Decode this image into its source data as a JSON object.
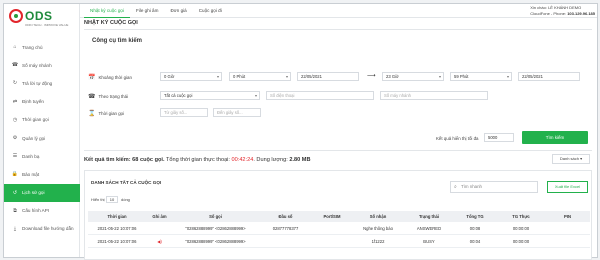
{
  "logo": {
    "text": "ODS",
    "subtitle": "ODIN TECH · IMPROVE VALUE"
  },
  "sidebar": {
    "items": [
      {
        "label": "Trang chủ",
        "icon": "home-icon",
        "active": false
      },
      {
        "label": "Số máy nhánh",
        "icon": "phone-icon",
        "active": false
      },
      {
        "label": "Trả lời tự động",
        "icon": "refresh-icon",
        "active": false
      },
      {
        "label": "Định tuyến",
        "icon": "route-icon",
        "active": false
      },
      {
        "label": "Thời gian gọi",
        "icon": "clock-icon",
        "active": false
      },
      {
        "label": "Quản lý gọi",
        "icon": "settings-icon",
        "active": false
      },
      {
        "label": "Danh bạ",
        "icon": "contacts-icon",
        "active": false
      },
      {
        "label": "Bảo mật",
        "icon": "lock-icon",
        "active": false
      },
      {
        "label": "Lịch sử gọi",
        "icon": "history-icon",
        "active": true
      },
      {
        "label": "Cấu hình API",
        "icon": "api-icon",
        "active": false
      },
      {
        "label": "Download file hướng dẫn",
        "icon": "download-icon",
        "active": false
      }
    ]
  },
  "tabs": [
    {
      "label": "Nhật ký cuộc gọi",
      "active": true
    },
    {
      "label": "File ghi âm",
      "active": false
    },
    {
      "label": "Đơn giá",
      "active": false
    },
    {
      "label": "Cuộc gọi đi",
      "active": false
    }
  ],
  "user": {
    "greeting_label": "Xin chào:",
    "name": "LÊ KHÁNH DEMO",
    "account_label": "CloudFone - Phone:",
    "phone": "103.129.96.185"
  },
  "page_title": "NHẬT KÝ CUỘC GỌI",
  "search": {
    "title": "Công cụ tìm kiếm",
    "time_range_label": "Khoảng thời gian",
    "from_hour": "0 Giờ",
    "from_minute": "0 Phút",
    "from_date": "22/05/2021",
    "to_hour": "23 Giờ",
    "to_minute": "59 Phút",
    "to_date": "22/05/2021",
    "status_label": "Theo trạng thái",
    "status_value": "Tất cả cuộc gọi",
    "phone_placeholder": "Số điện thoại",
    "extension_placeholder": "Số máy nhánh",
    "duration_label": "Thời gian gọi",
    "duration_from_placeholder": "Từ giây số...",
    "duration_to_placeholder": "Đến giây số...",
    "max_results_label": "Kết quả hiển thị tối đa",
    "max_results_value": "5000",
    "search_button": "Tìm kiếm"
  },
  "result": {
    "prefix": "Kết quả tìm kiếm: 68 cuộc gọi.",
    "time_text": " Tổng thời gian thực thoại: ",
    "time_value": "00:42:24",
    "capacity_text": ". Dung lượng: ",
    "capacity_value": "2.80 MB",
    "view_select": "Danh sách"
  },
  "table": {
    "title": "DANH SÁCH TẤT CẢ CUỘC GỌI",
    "search_placeholder": "Tìm nhanh",
    "export_button": "Xuất file Excel",
    "show_label": "Hiển thị",
    "show_value": "10",
    "rows_label": "dòng",
    "columns": [
      "Thời gian",
      "Ghi âm",
      "Số gọi",
      "Đầu số",
      "Port/SIM",
      "Số nhận",
      "Trạng thái",
      "Tổng TG",
      "TG Thực",
      "PIN"
    ],
    "rows": [
      [
        "2021-05-22 10:07:06",
        "",
        "\"02862888999\" <02862888999>",
        "02877778377",
        "",
        "Nghe thông báo",
        "ANSWERED",
        "00:08",
        "00:00:00",
        ""
      ],
      [
        "2021-05-22 10:07:06",
        "◀)",
        "\"02862888999\" <02862888999>",
        "",
        "",
        "1f1222",
        "BUSY",
        "00:04",
        "00:00:00",
        ""
      ]
    ]
  }
}
